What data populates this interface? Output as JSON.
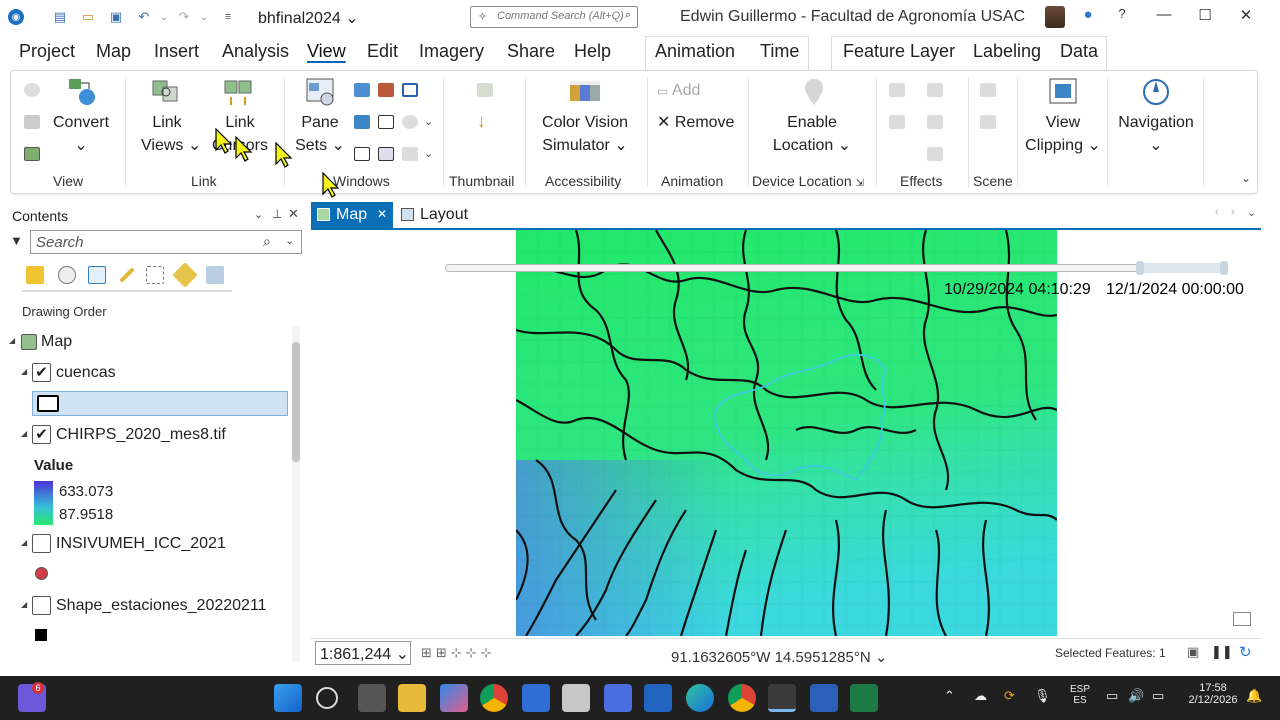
{
  "titlebar": {
    "project_name": "bhfinal2024",
    "command_search_placeholder": "Command Search (Alt+Q)",
    "user_title": "Edwin Guillermo - Facultad de Agronomía USAC",
    "help_label": "?"
  },
  "menu": {
    "tabs": [
      "Project",
      "Map",
      "Insert",
      "Analysis",
      "View",
      "Edit",
      "Imagery",
      "Share",
      "Help"
    ],
    "active": "View",
    "context_tabs_a": [
      "Animation",
      "Time"
    ],
    "context_tabs_b": [
      "Feature Layer",
      "Labeling",
      "Data"
    ]
  },
  "ribbon": {
    "convert_label": "Convert",
    "link_views_label": [
      "Link",
      "Views"
    ],
    "link_cursors_label": [
      "Link",
      "Cursors"
    ],
    "pane_sets_label": [
      "Pane",
      "Sets"
    ],
    "color_vision_label": [
      "Color Vision",
      "Simulator"
    ],
    "add_label": "Add",
    "remove_label": "Remove",
    "enable_location_label": [
      "Enable",
      "Location"
    ],
    "view_clipping_label": [
      "View",
      "Clipping"
    ],
    "navigation_label": "Navigation",
    "groups": [
      "View",
      "Link",
      "Windows",
      "Thumbnail",
      "Accessibility",
      "Animation",
      "Device Location",
      "Effects",
      "Scene"
    ]
  },
  "contents": {
    "title": "Contents",
    "search_placeholder": "Search",
    "drawing_order": "Drawing Order",
    "map_label": "Map",
    "layers": [
      {
        "name": "cuencas",
        "checked": true
      },
      {
        "name": "CHIRPS_2020_mes8.tif",
        "checked": true
      },
      {
        "name": "INSIVUMEH_ICC_2021",
        "checked": false
      },
      {
        "name": "Shape_estaciones_20220211",
        "checked": false
      }
    ],
    "value_label": "Value",
    "value_max": "633.073",
    "value_min": "87.9518"
  },
  "map_tabs": [
    "Map",
    "Layout"
  ],
  "time_slider": {
    "current": "10/29/2024 04:10:29",
    "end": "12/1/2024 00:00:00"
  },
  "status": {
    "scale": "1:861,244",
    "coordinates": "91.1632605°W 14.5951285°N",
    "selected_features": "Selected Features: 1"
  },
  "taskbar": {
    "badge": "6",
    "lang_top": "ESP",
    "lang_bottom": "ES",
    "time": "17:58",
    "date": "2/12/2026"
  },
  "colors": {
    "accent": "#0b6fb8",
    "raster_high": "#3b3fd8",
    "raster_low": "#22e86a",
    "basin_outline": "#111111",
    "highlight_basin": "#3fc9e0"
  }
}
